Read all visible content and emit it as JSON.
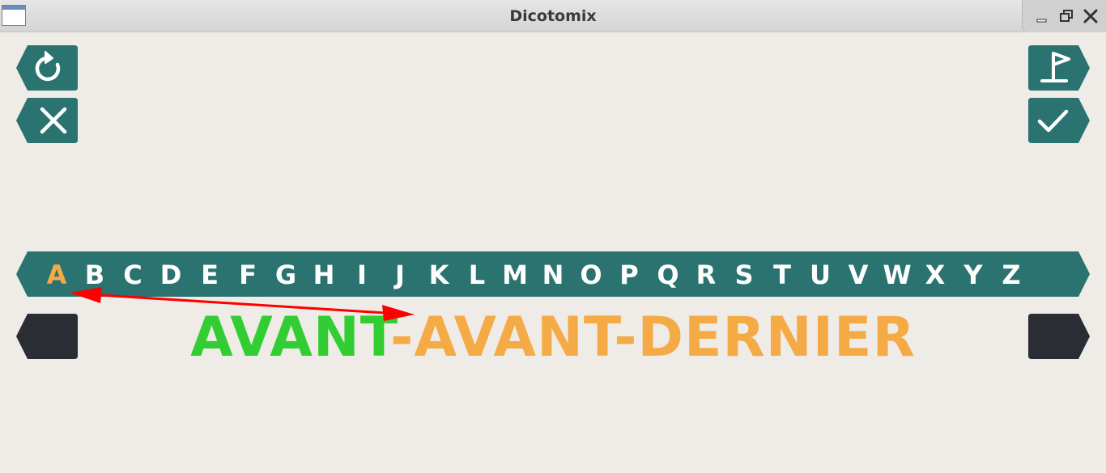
{
  "window": {
    "title": "Dicotomix"
  },
  "alphabet": {
    "letters": [
      "A",
      "B",
      "C",
      "D",
      "E",
      "F",
      "G",
      "H",
      "I",
      "J",
      "K",
      "L",
      "M",
      "N",
      "O",
      "P",
      "Q",
      "R",
      "S",
      "T",
      "U",
      "V",
      "W",
      "X",
      "Y",
      "Z"
    ],
    "highlighted": "A"
  },
  "word": {
    "prefix": "AVANT",
    "rest": "-AVANT-DERNIER"
  },
  "icons": {
    "undo": "undo-icon",
    "cancel": "close-icon",
    "finish": "flag-icon",
    "confirm": "check-icon"
  },
  "colors": {
    "background": "#efece8",
    "button": "#2b7370",
    "dark_button": "#2a2d33",
    "letter": "#ffffff",
    "highlight": "#f4ab45",
    "matched": "#32cd32",
    "arrow": "#ff0000"
  }
}
